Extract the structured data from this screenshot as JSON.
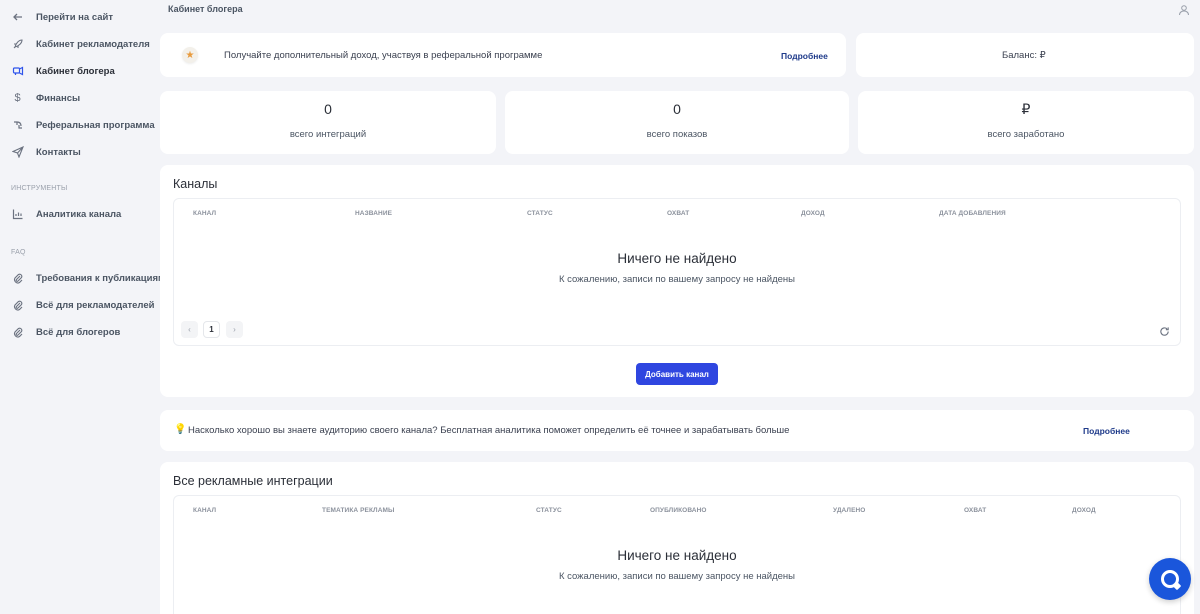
{
  "sidebar": {
    "items": [
      {
        "label": "Перейти на сайт",
        "icon": "arrow-left-icon"
      },
      {
        "label": "Кабинет рекламодателя",
        "icon": "rocket-icon"
      },
      {
        "label": "Кабинет блогера",
        "icon": "megaphone-icon"
      },
      {
        "label": "Финансы",
        "icon": "dollar-icon"
      },
      {
        "label": "Реферальная программа",
        "icon": "referral-icon"
      },
      {
        "label": "Контакты",
        "icon": "paper-plane-icon"
      }
    ],
    "tools_title": "ИНСТРУМЕНТЫ",
    "tools": [
      {
        "label": "Аналитика канала",
        "icon": "bar-chart-icon"
      }
    ],
    "faq_title": "FAQ",
    "faq": [
      {
        "label": "Требования к публикациям",
        "icon": "paperclip-icon"
      },
      {
        "label": "Всё для рекламодателей",
        "icon": "paperclip-icon"
      },
      {
        "label": "Всё для блогеров",
        "icon": "paperclip-icon"
      }
    ]
  },
  "header": {
    "breadcrumb": "Кабинет блогера"
  },
  "referral_banner": {
    "text": "Получайте дополнительный доход, участвуя в реферальной программе",
    "link": "Подробнее"
  },
  "balance": {
    "text": "Баланс:  ₽"
  },
  "stats": [
    {
      "value": "0",
      "label": "всего интеграций"
    },
    {
      "value": "0",
      "label": "всего показов"
    },
    {
      "value": "₽",
      "label": "всего заработано"
    }
  ],
  "channels": {
    "title": "Каналы",
    "columns": [
      "КАНАЛ",
      "НАЗВАНИЕ",
      "СТАТУС",
      "ОХВАТ",
      "ДОХОД",
      "ДАТА ДОБАВЛЕНИЯ"
    ],
    "empty_title": "Ничего не найдено",
    "empty_sub": "К сожалению, записи по вашему запросу не найдены",
    "pager": {
      "prev": "‹",
      "current": "1",
      "next": "›"
    },
    "add_button": "Добавить канал"
  },
  "tip": {
    "icon": "💡",
    "text": "Насколько хорошо вы знаете аудиторию своего канала? Бесплатная аналитика поможет определить её точнее и зарабатывать больше",
    "link": "Подробнее"
  },
  "integrations": {
    "title": "Все рекламные интеграции",
    "columns": [
      "КАНАЛ",
      "ТЕМАТИКА РЕКЛАМЫ",
      "СТАТУС",
      "ОПУБЛИКОВАНО",
      "УДАЛЕНО",
      "ОХВАТ",
      "ДОХОД"
    ],
    "empty_title": "Ничего не найдено",
    "empty_sub": "К сожалению, записи по вашему запросу не найдены"
  },
  "colors": {
    "accent": "#2f46e0",
    "link": "#1e3a8a",
    "chat": "#1a56db"
  }
}
